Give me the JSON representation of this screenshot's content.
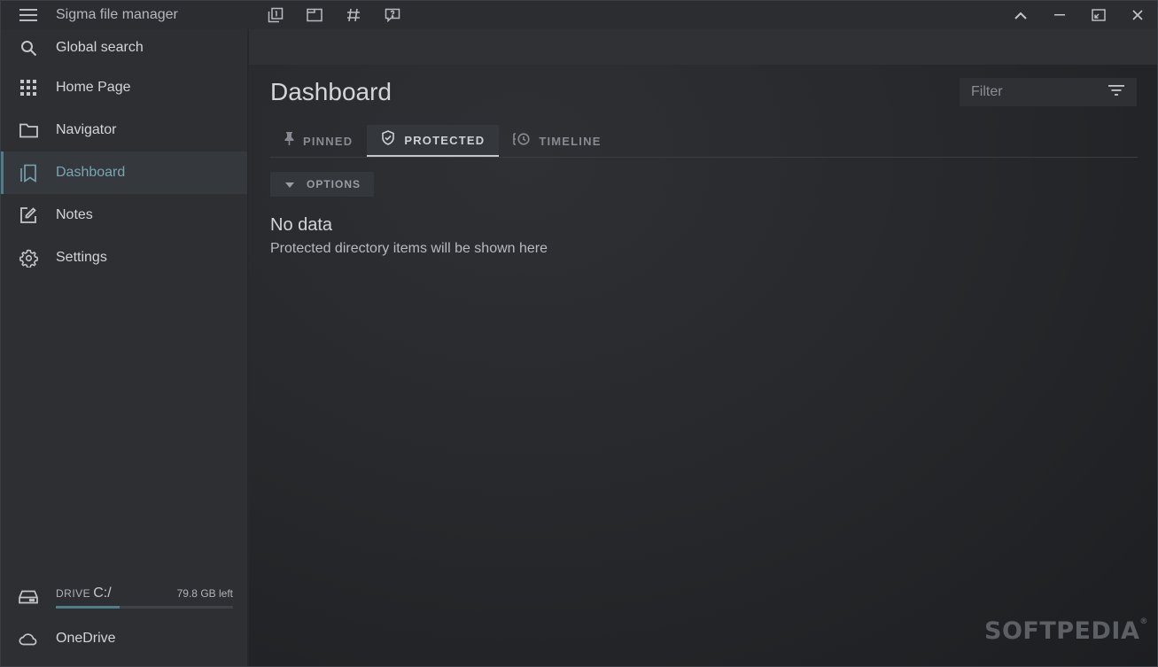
{
  "app": {
    "title": "Sigma file manager"
  },
  "sidebar": {
    "items": [
      {
        "label": "Global search",
        "icon": "search-icon"
      },
      {
        "label": "Home Page",
        "icon": "grid-icon"
      },
      {
        "label": "Navigator",
        "icon": "folder-icon"
      },
      {
        "label": "Dashboard",
        "icon": "bookmark-icon",
        "active": true
      },
      {
        "label": "Notes",
        "icon": "edit-note-icon"
      },
      {
        "label": "Settings",
        "icon": "gear-icon"
      }
    ],
    "drive": {
      "type_label": "DRIVE",
      "path": "C:/",
      "free": "79.8 GB left",
      "used_fraction": 0.36
    },
    "onedrive": {
      "label": "OneDrive"
    }
  },
  "main": {
    "title": "Dashboard",
    "filter_placeholder": "Filter",
    "tabs": [
      {
        "label": "PINNED",
        "icon": "pin-icon"
      },
      {
        "label": "PROTECTED",
        "icon": "shield-check-icon",
        "active": true
      },
      {
        "label": "TIMELINE",
        "icon": "history-icon"
      }
    ],
    "options_label": "OPTIONS",
    "empty_title": "No data",
    "empty_subtitle": "Protected directory items will be shown here"
  },
  "watermark": {
    "text": "SOFTPEDIA",
    "mark": "®"
  },
  "colors": {
    "accent": "#4f7d8a",
    "background": "#26282c",
    "sidebar": "#2d2f33"
  }
}
